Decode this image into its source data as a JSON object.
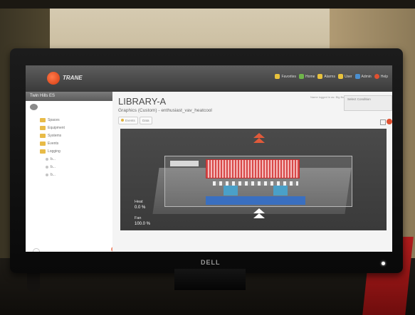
{
  "app": {
    "logo_text": "TRANE"
  },
  "topnav": [
    {
      "label": "Favorites",
      "color": "#e8c23c"
    },
    {
      "label": "Home",
      "color": "#6fb54a"
    },
    {
      "label": "Alarms",
      "color": "#e8c23c"
    },
    {
      "label": "User",
      "color": "#e8c23c"
    },
    {
      "label": "Admin",
      "color": "#4a8fd0"
    },
    {
      "label": "Help",
      "color": "#e05030"
    }
  ],
  "sidebar": {
    "title": "Twin Hills ES",
    "items": [
      {
        "label": "Spaces",
        "type": "folder"
      },
      {
        "label": "Equipment",
        "type": "folder"
      },
      {
        "label": "Systems",
        "type": "folder"
      },
      {
        "label": "Events",
        "type": "folder"
      },
      {
        "label": "Logging",
        "type": "folder"
      },
      {
        "label": "b...",
        "type": "leaf"
      },
      {
        "label": "b...",
        "type": "leaf"
      },
      {
        "label": "b...",
        "type": "leaf"
      }
    ]
  },
  "main": {
    "title": "LIBRARY-A",
    "subtitle": "Graphics (Custom) - enthusiast_vav_heatcool",
    "chips": [
      "Events",
      "Data"
    ],
    "user_info": "Name logged in as: Big Boss (admin)",
    "context_button": "Select Condition"
  },
  "graphic": {
    "readouts": [
      {
        "label": "Heat",
        "value": "0.0 %"
      },
      {
        "label": "Fan",
        "value": "100.0 %"
      }
    ]
  },
  "monitor": {
    "brand": "DELL"
  },
  "colors": {
    "accent": "#e05a3a",
    "topbar": "#4a4a4a",
    "folder": "#e8bb48"
  }
}
